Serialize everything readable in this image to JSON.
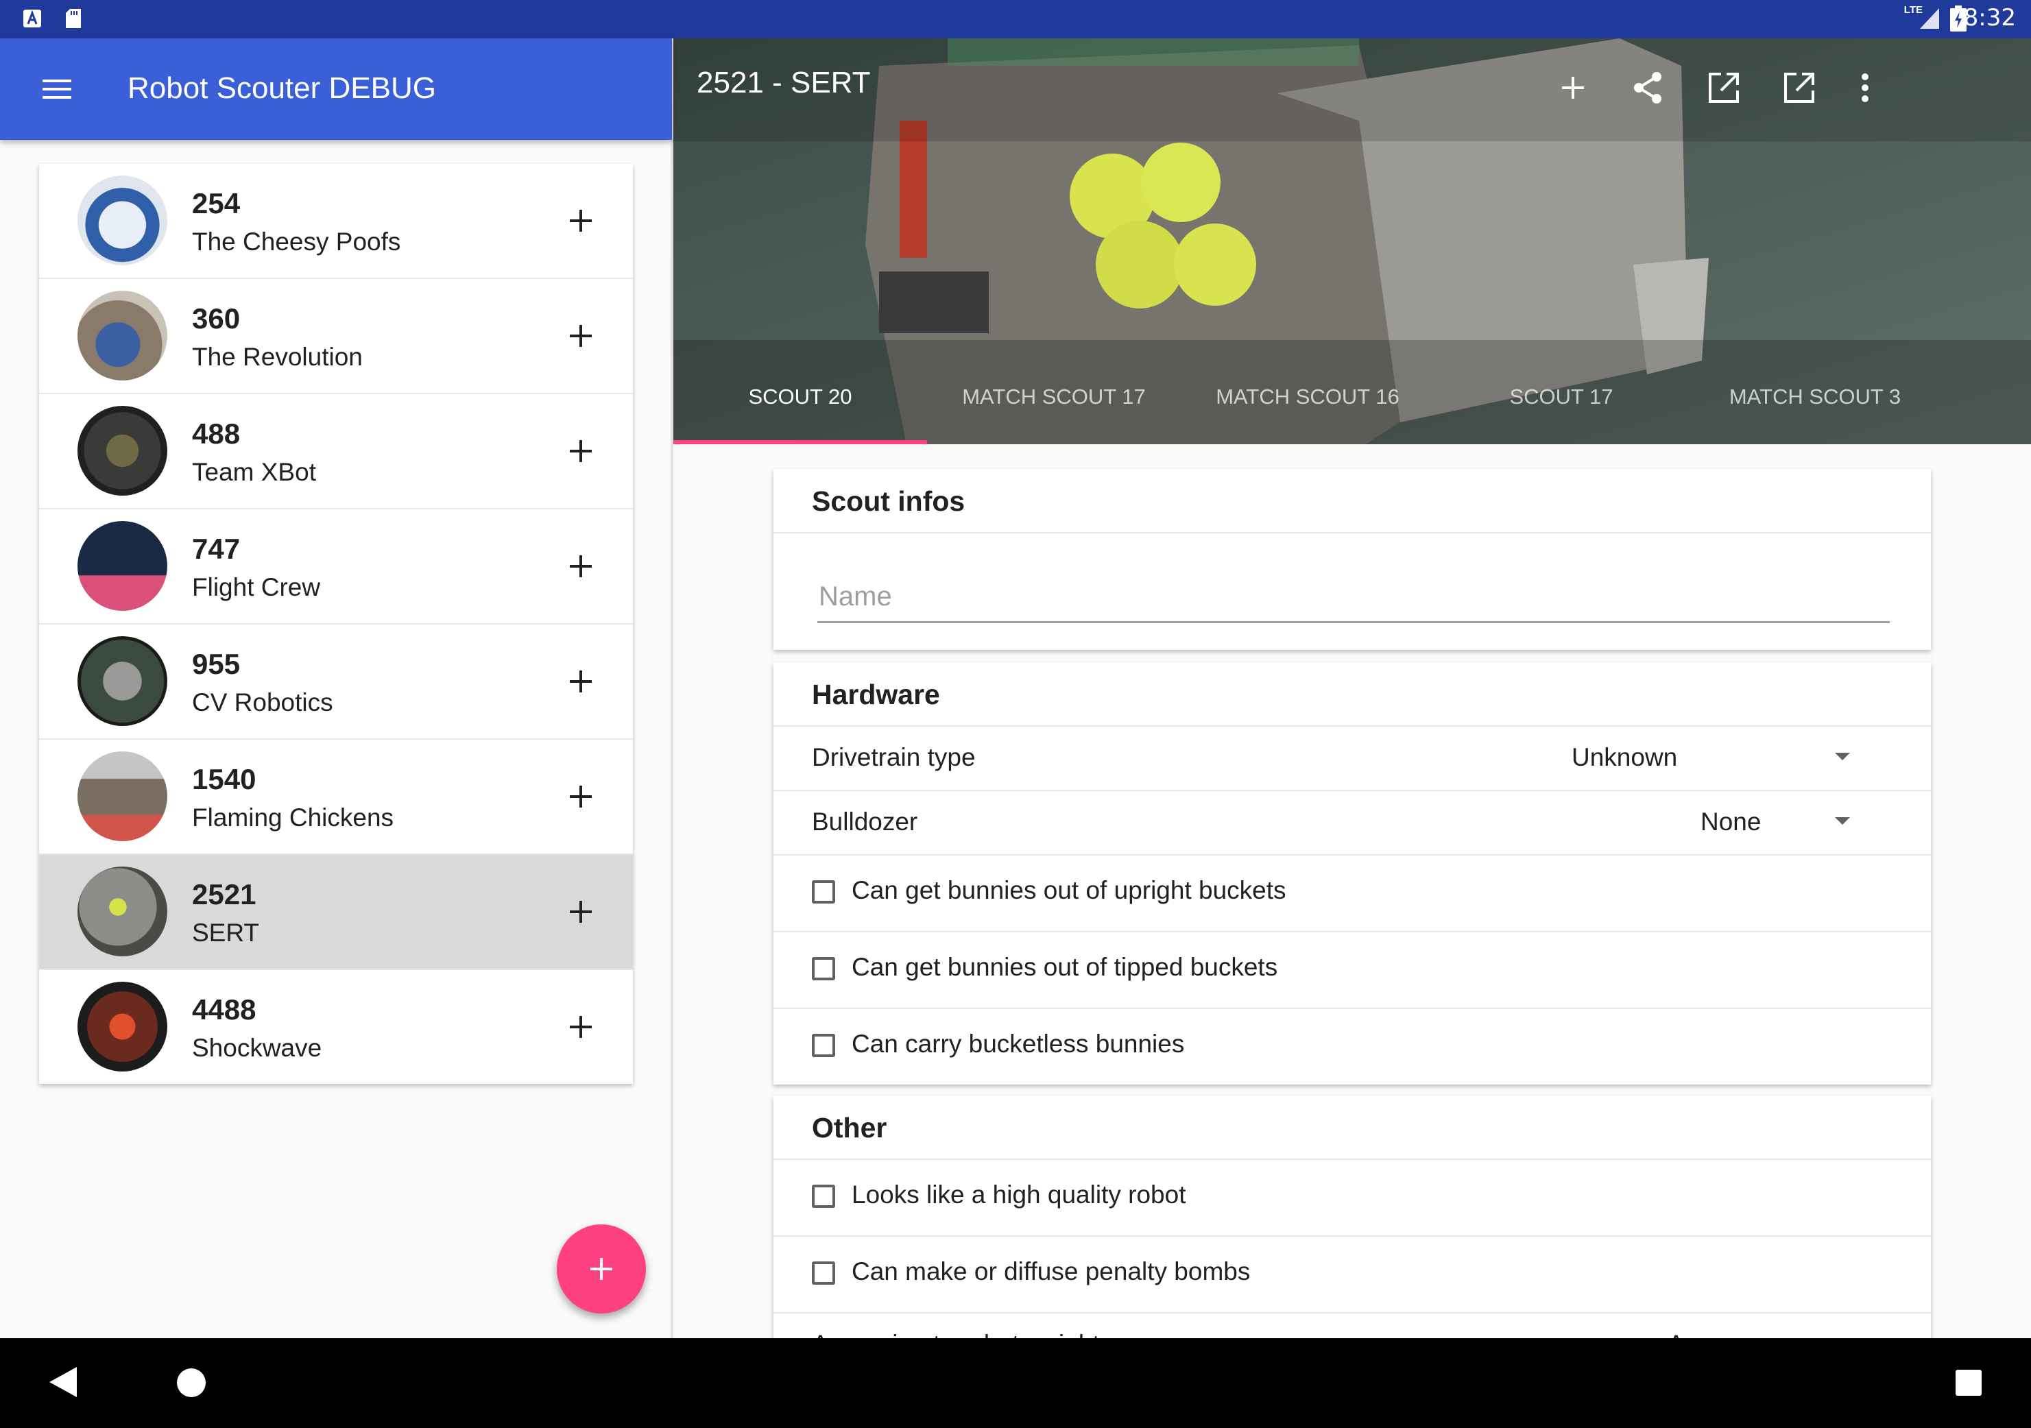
{
  "status_bar": {
    "time": "8:32",
    "network": "LTE",
    "left_icons": [
      "a-notification-icon",
      "sd-card-icon"
    ],
    "right_icons": [
      "signal-icon",
      "battery-charging-icon"
    ]
  },
  "app_bar": {
    "title": "Robot Scouter DEBUG",
    "menu_icon": "hamburger-menu-icon"
  },
  "teams": [
    {
      "number": "254",
      "name": "The Cheesy Poofs",
      "selected": false
    },
    {
      "number": "360",
      "name": "The Revolution",
      "selected": false
    },
    {
      "number": "488",
      "name": "Team XBot",
      "selected": false
    },
    {
      "number": "747",
      "name": "Flight Crew",
      "selected": false
    },
    {
      "number": "955",
      "name": "CV Robotics",
      "selected": false
    },
    {
      "number": "1540",
      "name": "Flaming Chickens",
      "selected": false
    },
    {
      "number": "2521",
      "name": "SERT",
      "selected": true
    },
    {
      "number": "4488",
      "name": "Shockwave",
      "selected": false
    }
  ],
  "fab": {
    "icon": "plus-icon"
  },
  "detail": {
    "title": "2521 - SERT",
    "actions": [
      "add-icon",
      "share-icon",
      "open-in-new-icon",
      "open-in-new-icon",
      "more-vert-icon"
    ],
    "tabs": [
      "SCOUT 20",
      "MATCH SCOUT 17",
      "MATCH SCOUT 16",
      "SCOUT 17",
      "MATCH SCOUT 3"
    ],
    "active_tab": 0
  },
  "scout_infos": {
    "title": "Scout infos",
    "name_placeholder": "Name",
    "name_value": ""
  },
  "hardware": {
    "title": "Hardware",
    "drivetrain_label": "Drivetrain type",
    "drivetrain_value": "Unknown",
    "bulldozer_label": "Bulldozer",
    "bulldozer_value": "None",
    "checks": [
      "Can get bunnies out of upright buckets",
      "Can get bunnies out of tipped buckets",
      "Can carry bucketless bunnies"
    ]
  },
  "other": {
    "title": "Other",
    "checks": [
      "Looks like a high quality robot",
      "Can make or diffuse penalty bombs"
    ],
    "weight_label": "Approximate robot weight",
    "weight_value": "Average"
  },
  "colors": {
    "status_bar": "#203a9c",
    "app_bar": "#3a5fd6",
    "accent": "#ff4081",
    "selected_row": "#d9d9d9"
  }
}
